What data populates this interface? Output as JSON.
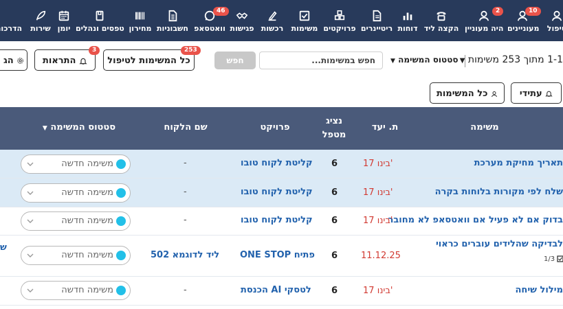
{
  "nav": {
    "items": [
      {
        "key": "treatment",
        "label": "טיפול"
      },
      {
        "key": "clients",
        "label": "מעוניינים",
        "badge": "10"
      },
      {
        "key": "was-interested",
        "label": "היה מעוניין",
        "badge": "2"
      },
      {
        "key": "assign-lead",
        "label": "הקצה ליד"
      },
      {
        "key": "reports",
        "label": "דוחות"
      },
      {
        "key": "retainers",
        "label": "ריטיינרים"
      },
      {
        "key": "projects",
        "label": "פרויקטים"
      },
      {
        "key": "tasks",
        "label": "משימות"
      },
      {
        "key": "purchases",
        "label": "רכשות"
      },
      {
        "key": "meetings",
        "label": "פגישות"
      },
      {
        "key": "whatsapp",
        "label": "וואטסאפ",
        "badge": "46"
      },
      {
        "key": "invoices",
        "label": "חשבוניות"
      },
      {
        "key": "pricelist",
        "label": "מחירון"
      },
      {
        "key": "forms",
        "label": "טפסים ונהלים"
      },
      {
        "key": "calendar",
        "label": "יומן"
      },
      {
        "key": "services",
        "label": "שירות"
      },
      {
        "key": "training",
        "label": "הדרכות"
      }
    ]
  },
  "toolbar": {
    "count_text": "1-1 מתוך 253 משימות",
    "status_filter": "סטטוס המשימה",
    "search_placeholder": "חפש במשימות...",
    "search_button": "חפש",
    "all_tasks_label": "כל המשימות לטיפול",
    "all_tasks_badge": "253",
    "alerts_label": "התראות",
    "alerts_badge": "3",
    "settings_label": "הג",
    "future_label": "עתידי",
    "all_label": "כל המשימות"
  },
  "table": {
    "headers": {
      "task": "משימה",
      "due": "ת. יעד",
      "rep_line1": "נציג",
      "rep_line2": "מטפל",
      "project": "פרויקט",
      "client": "שם הלקוח",
      "status": "סטטוס המשימה"
    },
    "rows": [
      {
        "task": "תאריך מחיקת מערכת",
        "due": "17 בינו'",
        "rep": "6",
        "project": "קליטת לקוח טובו",
        "client": "-",
        "status": "משימה חדשה"
      },
      {
        "task": "שלח לפי מקורות בלוחות בקרה",
        "due": "17 בינו'",
        "rep": "6",
        "project": "קליטת לקוח טובו",
        "client": "-",
        "status": "משימה חדשה"
      },
      {
        "task": "בדוק אם לא פעיל אם וואטסאפ לא מחובר",
        "due": "17 בינו'",
        "rep": "6",
        "project": "קליטת לקוח טובו",
        "client": "-",
        "status": "משימה חדשה"
      },
      {
        "task": "לבדיקה שהלידים עוברים כראוי",
        "subtask": "1/3",
        "due": "11.12.25",
        "rep": "6",
        "project": "ONE STOP פתיח",
        "client": "ליד לדוגמא 502",
        "status": "משימה חדשה",
        "side_link": "ש"
      },
      {
        "task": "מילול שיחה",
        "due": "17 בינו'",
        "rep": "6",
        "project": "הכנסת AI לטסקי",
        "client": "-",
        "status": "משימה חדשה"
      }
    ]
  }
}
